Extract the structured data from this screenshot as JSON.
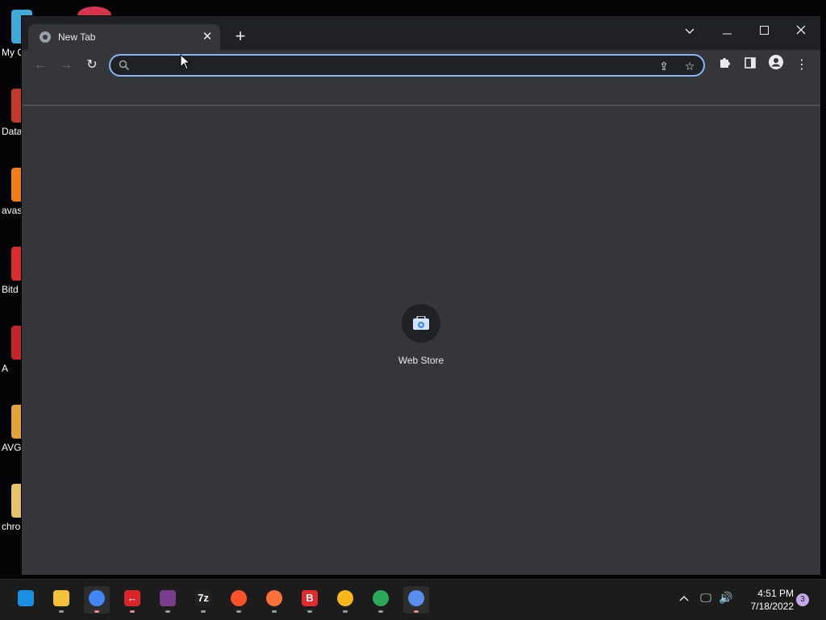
{
  "desktop": {
    "icons": [
      {
        "label": "My C",
        "color": "#3fa9d9"
      },
      {
        "label": "Data",
        "color": "#c0392b"
      },
      {
        "label": "avast",
        "color": "#f07f1b"
      },
      {
        "label": "Bitd",
        "color": "#d62d2d"
      },
      {
        "label": "A",
        "color": "#c1272d"
      },
      {
        "label": "AVG",
        "color": "#e0a23a"
      },
      {
        "label": "chro",
        "color": "#e6c36a"
      }
    ]
  },
  "browser": {
    "tab": {
      "title": "New Tab",
      "close": "✕"
    },
    "new_tab": "+",
    "window_controls": {
      "tab_search": "⌄",
      "minimize": "—",
      "maximize": "☐",
      "close": "✕"
    },
    "toolbar": {
      "back": "←",
      "forward": "→",
      "reload": "↻",
      "share": "⇪",
      "star": "☆",
      "extensions": "✱",
      "side_panel": "▯",
      "profile": "●",
      "menu": "⋮"
    },
    "omnibox": {
      "value": "",
      "placeholder": ""
    },
    "shortcut": {
      "label": "Web Store",
      "icon": "web-store-icon"
    }
  },
  "taskbar": {
    "apps": [
      {
        "name": "start",
        "glyph": "",
        "color": "#1a8fe3"
      },
      {
        "name": "file-explorer",
        "glyph": "",
        "color": "#f3c23a"
      },
      {
        "name": "chrome",
        "glyph": "",
        "color": "#4285f4"
      },
      {
        "name": "avira",
        "glyph": "←",
        "color": "#d9252a"
      },
      {
        "name": "winrar",
        "glyph": "",
        "color": "#7a3c8c"
      },
      {
        "name": "7zip",
        "glyph": "7z",
        "color": "#222222"
      },
      {
        "name": "brave",
        "glyph": "",
        "color": "#fb542b"
      },
      {
        "name": "firefox",
        "glyph": "",
        "color": "#ff7139"
      },
      {
        "name": "bitdefender",
        "glyph": "B",
        "color": "#e02c2c"
      },
      {
        "name": "chrome-canary",
        "glyph": "",
        "color": "#f9b719"
      },
      {
        "name": "edge-canary",
        "glyph": "",
        "color": "#2ba95b"
      },
      {
        "name": "chromium",
        "glyph": "",
        "color": "#5a8dee"
      }
    ],
    "tray": {
      "chevron": "^",
      "network": "🖵",
      "volume": "🔊"
    },
    "time": "4:51 PM",
    "date": "7/18/2022",
    "notifications": "3"
  }
}
